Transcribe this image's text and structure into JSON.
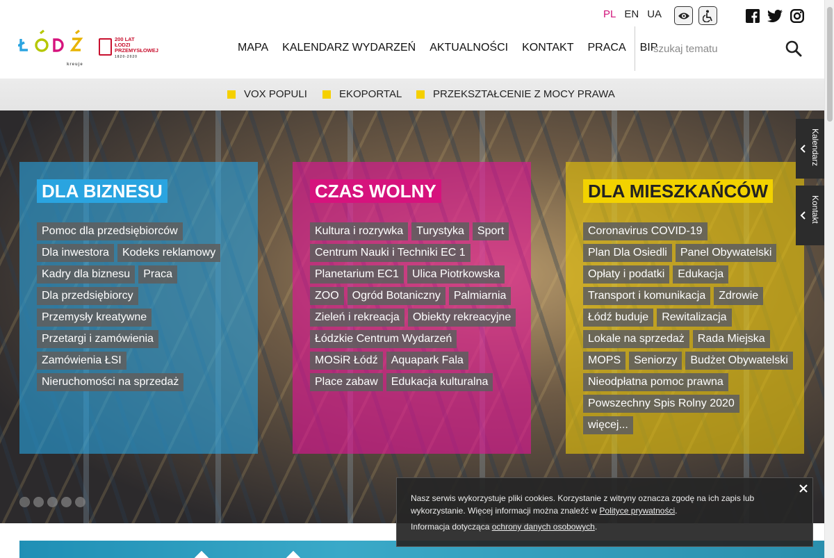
{
  "header": {
    "logo_text": "ŁÓDŹ",
    "logo_caption": "kreuje",
    "anniversary": {
      "line1": "200 LAT",
      "line2": "ŁODZI",
      "line3": "PRZEMYSŁOWEJ",
      "years": "1820-2020"
    },
    "languages": [
      {
        "label": "PL",
        "active": true
      },
      {
        "label": "EN",
        "active": false
      },
      {
        "label": "UA",
        "active": false
      }
    ],
    "tools": [
      "eye-icon",
      "accessibility-icon"
    ],
    "social": [
      "facebook-icon",
      "twitter-icon",
      "instagram-icon"
    ],
    "nav": [
      "MAPA",
      "KALENDARZ WYDARZEŃ",
      "AKTUALNOŚCI",
      "KONTAKT",
      "PRACA",
      "BIP"
    ],
    "search": {
      "placeholder": "szukaj tematu",
      "value": ""
    }
  },
  "subbar": {
    "items": [
      "VOX POPULI",
      "EKOPORTAL",
      "PRZEKSZTAŁCENIE Z MOCY PRAWA"
    ],
    "accent": "#f5d000"
  },
  "panels": {
    "business": {
      "title": "DLA BIZNESU",
      "color": "#2aa4e0",
      "rows": [
        [
          "Pomoc dla przedsiębiorców"
        ],
        [
          "Dla inwestora",
          "Kodeks reklamowy"
        ],
        [
          "Kadry dla biznesu",
          "Praca"
        ],
        [
          "Dla przedsiębiorcy"
        ],
        [
          "Przemysły kreatywne"
        ],
        [
          "Przetargi i zamówienia"
        ],
        [
          "Zamówienia ŁSI"
        ],
        [
          "Nieruchomości na sprzedaż"
        ]
      ]
    },
    "free_time": {
      "title": "CZAS WOLNY",
      "color": "#d6137d",
      "rows": [
        [
          "Kultura i rozrywka",
          "Turystyka",
          "Sport"
        ],
        [
          "Centrum Nauki i Techniki EC 1"
        ],
        [
          "Planetarium EC1",
          "Ulica Piotrkowska"
        ],
        [
          "ZOO",
          "Ogród Botaniczny",
          "Palmiarnia"
        ],
        [
          "Zieleń i rekreacja",
          "Obiekty rekreacyjne"
        ],
        [
          "Łódzkie Centrum Wydarzeń"
        ],
        [
          "MOSiR Łódź",
          "Aquapark Fala"
        ],
        [
          "Place zabaw",
          "Edukacja kulturalna"
        ]
      ]
    },
    "residents": {
      "title": "DLA MIESZKAŃCÓW",
      "color": "#f2d200",
      "rows": [
        [
          "Coronavirus COVID-19"
        ],
        [
          "Plan Dla Osiedli",
          "Panel Obywatelski"
        ],
        [
          "Opłaty i podatki",
          "Edukacja"
        ],
        [
          "Transport i komunikacja",
          "Zdrowie"
        ],
        [
          "Łódź buduje",
          "Rewitalizacja"
        ],
        [
          "Lokale na sprzedaż",
          "Rada Miejska"
        ],
        [
          "MOPS",
          "Seniorzy",
          "Budżet Obywatelski"
        ],
        [
          "Nieodpłatna pomoc prawna"
        ],
        [
          "Powszechny Spis Rolny 2020"
        ],
        [
          "więcej..."
        ]
      ]
    }
  },
  "slider": {
    "count": 5,
    "active_index": 0
  },
  "side_tabs": [
    "Kalendarz",
    "Kontakt"
  ],
  "cookie": {
    "text_before": "Nasz serwis wykorzystuje pliki cookies. Korzystanie z witryny oznacza zgodę na ich zapis lub wykorzystanie. Więcej informacji można znaleźć w ",
    "link1": "Polityce prywatności",
    "text_after": ".",
    "text2_before": "Informacja dotycząca ",
    "link2": "ochrony danych osobowych",
    "text2_after": "."
  }
}
